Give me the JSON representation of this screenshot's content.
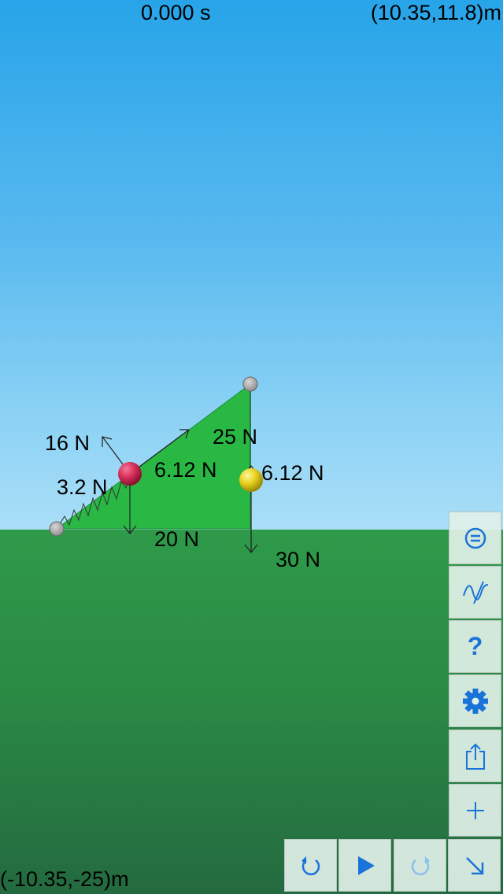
{
  "header": {
    "time": "0.000 s",
    "coord_max": "(10.35,11.8)m"
  },
  "footer": {
    "coord_min": "(-10.35,-25)m"
  },
  "forces": {
    "normal_red": "16 N",
    "spring_red": "3.2 N",
    "tension_red": "6.12 N",
    "gravity_red": "20 N",
    "tension_incline": "25 N",
    "tension_yellow": "6.12 N",
    "gravity_yellow": "30 N"
  },
  "colors": {
    "incline": "#2ab844",
    "red_ball": "#d8305a",
    "yellow_ball": "#e8d220",
    "icon_blue": "#1a73d9"
  },
  "icons": {
    "sidebar": [
      "menu-icon",
      "graph-icon",
      "help-icon",
      "settings-gear-icon",
      "share-icon",
      "add-icon"
    ],
    "bottom": [
      "reset-icon",
      "play-icon",
      "redo-icon",
      "arrow-tool-icon"
    ]
  }
}
